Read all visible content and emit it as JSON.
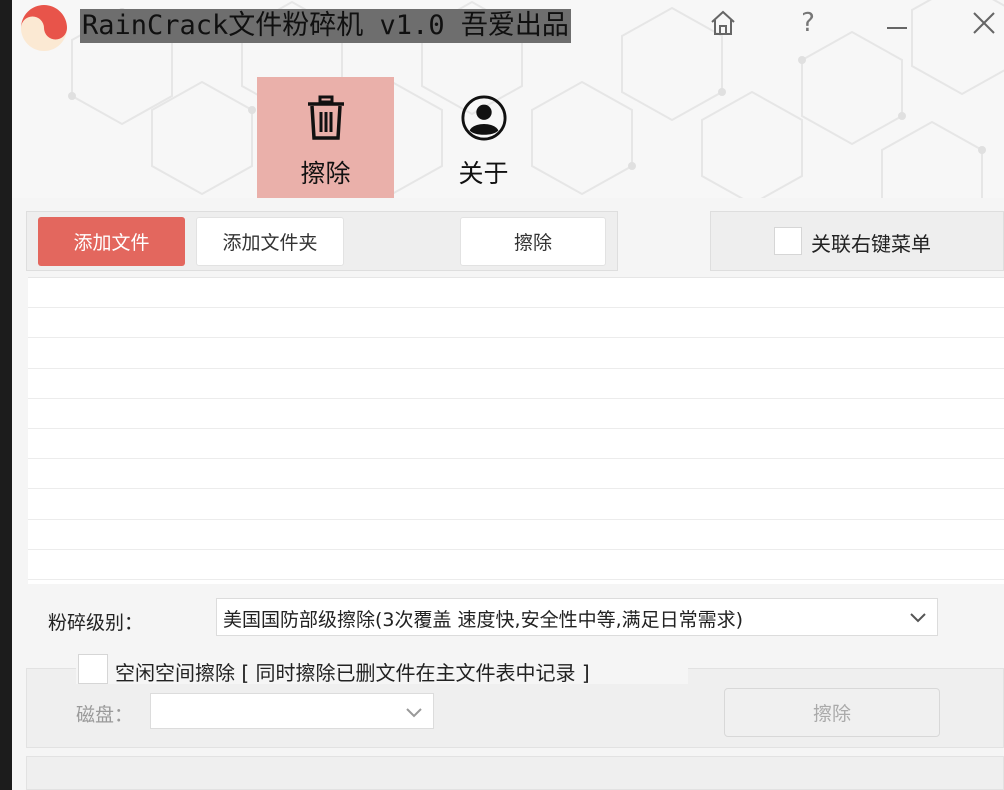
{
  "window": {
    "title": "RainCrack文件粉碎机 v1.0 吾爱出品",
    "help_glyph": "?"
  },
  "nav": {
    "tabs": [
      {
        "label": "擦除",
        "icon": "trash-icon",
        "active": true
      },
      {
        "label": "关于",
        "icon": "user-icon",
        "active": false
      }
    ]
  },
  "toolbar": {
    "add_file_label": "添加文件",
    "add_folder_label": "添加文件夹",
    "erase_label": "擦除"
  },
  "context_menu": {
    "label": "关联右键菜单",
    "checked": false
  },
  "file_list": {
    "rows": [
      "",
      "",
      "",
      "",
      "",
      "",
      "",
      "",
      "",
      ""
    ]
  },
  "shred_level": {
    "label": "粉碎级别：",
    "selected": "美国国防部级擦除(3次覆盖 速度快,安全性中等,满足日常需求)"
  },
  "idle_space": {
    "label": "空闲空间擦除 [ 同时擦除已删文件在主文件表中记录 ]",
    "checked": false,
    "disk_label": "磁盘：",
    "disk_selected": "",
    "erase_label": "擦除"
  },
  "colors": {
    "accent": "#e3675e",
    "active_tab": "#eab0aa",
    "logo_red": "#e8544a"
  }
}
